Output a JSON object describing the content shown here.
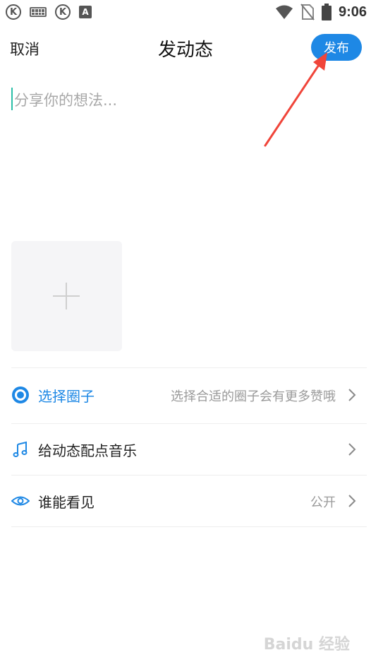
{
  "status_bar": {
    "left_icons": [
      "k-icon",
      "keyboard-icon",
      "k-icon",
      "a-icon"
    ],
    "k_letter": "K",
    "a_letter": "A",
    "right_icons": [
      "wifi-icon",
      "no-sim-icon",
      "battery-icon"
    ],
    "time": "9:06"
  },
  "header": {
    "cancel_label": "取消",
    "title": "发动态",
    "publish_label": "发布"
  },
  "composer": {
    "placeholder": "分享你的想法..."
  },
  "add_photo": {
    "icon": "plus-icon"
  },
  "options": [
    {
      "icon": "target-icon",
      "label": "选择圈子",
      "value": "选择合适的圈子会有更多赞哦",
      "highlight": true
    },
    {
      "icon": "music-note-icon",
      "label": "给动态配点音乐",
      "value": ""
    },
    {
      "icon": "eye-icon",
      "label": "谁能看见",
      "value": "公开"
    }
  ],
  "watermark": "Baidu 经验",
  "colors": {
    "accent": "#1e88e5",
    "annotation": "#f0453a"
  }
}
